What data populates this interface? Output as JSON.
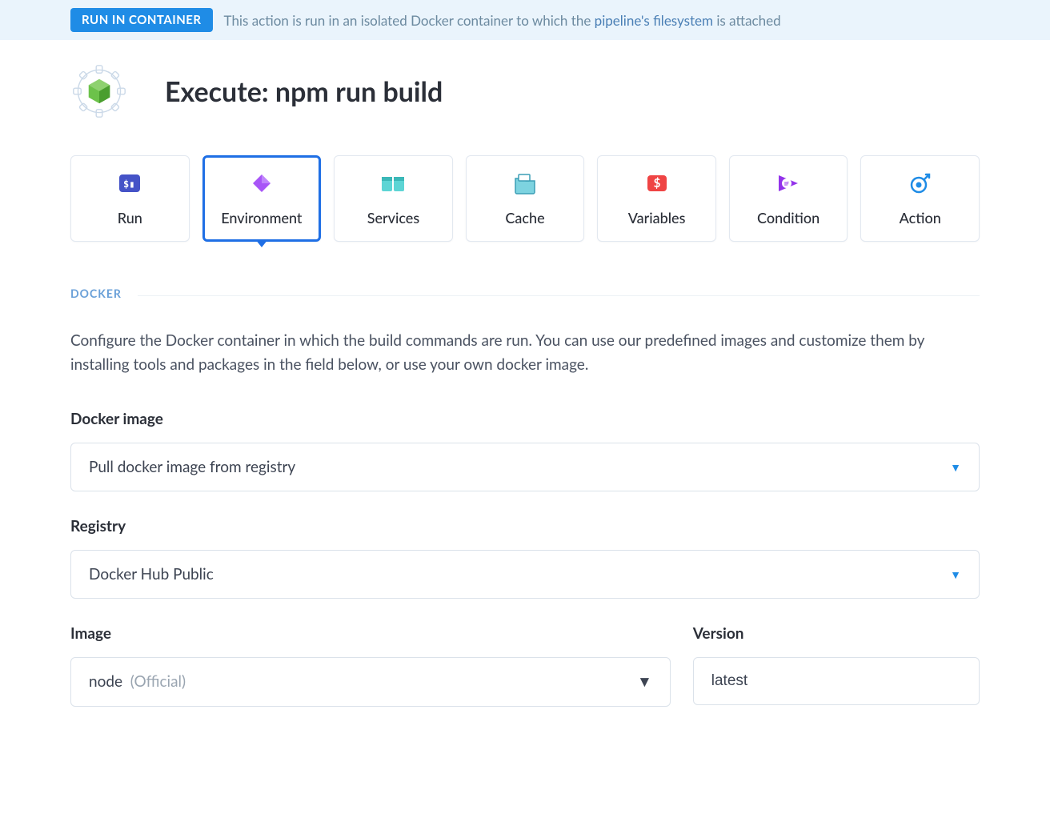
{
  "banner": {
    "badge": "RUN IN CONTAINER",
    "text_prefix": "This action is run in an isolated Docker container to which the ",
    "link": "pipeline's filesystem",
    "text_suffix": " is attached"
  },
  "header": {
    "title": "Execute: npm run build"
  },
  "tabs": [
    {
      "label": "Run"
    },
    {
      "label": "Environment"
    },
    {
      "label": "Services"
    },
    {
      "label": "Cache"
    },
    {
      "label": "Variables"
    },
    {
      "label": "Condition"
    },
    {
      "label": "Action"
    }
  ],
  "section": {
    "label": "DOCKER",
    "description": "Configure the Docker container in which the build commands are run. You can use our predefined images and customize them by installing tools and packages in the field below, or use your own docker image."
  },
  "fields": {
    "docker_image_label": "Docker image",
    "docker_image_value": "Pull docker image from registry",
    "registry_label": "Registry",
    "registry_value": "Docker Hub Public",
    "image_label": "Image",
    "image_value": "node",
    "image_tag": "(Official)",
    "version_label": "Version",
    "version_value": "latest"
  }
}
